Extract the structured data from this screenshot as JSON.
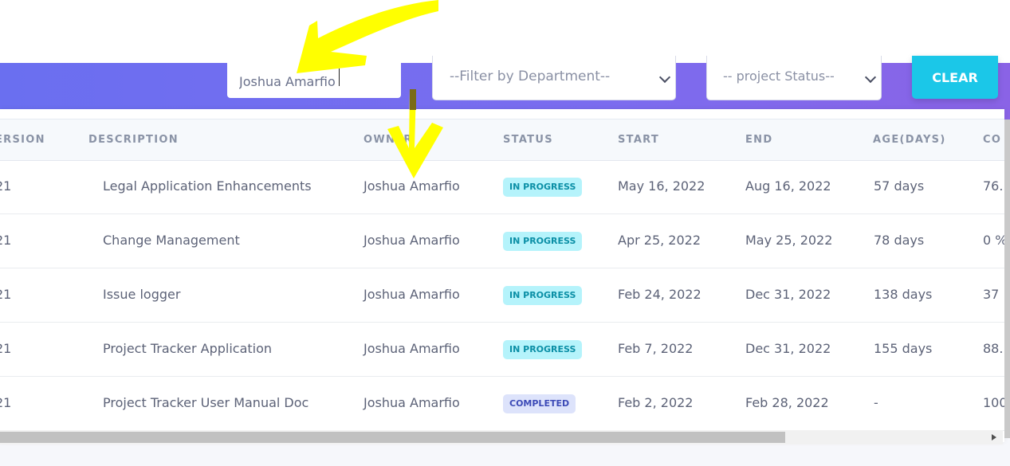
{
  "filters": {
    "search_value": "Joshua Amarfio",
    "department_placeholder": "--Filter by Department--",
    "status_placeholder": "-- project Status--",
    "clear_label": "CLEAR"
  },
  "table": {
    "headers": {
      "version": "ERSION",
      "description": "DESCRIPTION",
      "owner": "OWNER",
      "status": "STATUS",
      "start": "START",
      "end": "END",
      "age": "AGE(DAYS)",
      "completion": "CO"
    },
    "rows": [
      {
        "version": "21",
        "description": "Legal Application Enhancements",
        "owner": "Joshua Amarfio",
        "status": "IN PROGRESS",
        "status_type": "progress",
        "start": "May 16, 2022",
        "end": "Aug 16, 2022",
        "age": "57 days",
        "completion": "76."
      },
      {
        "version": "21",
        "description": "Change Management",
        "owner": "Joshua Amarfio",
        "status": "IN PROGRESS",
        "status_type": "progress",
        "start": "Apr 25, 2022",
        "end": "May 25, 2022",
        "age": "78 days",
        "completion": "0 %"
      },
      {
        "version": "21",
        "description": "Issue logger",
        "owner": "Joshua Amarfio",
        "status": "IN PROGRESS",
        "status_type": "progress",
        "start": "Feb 24, 2022",
        "end": "Dec 31, 2022",
        "age": "138 days",
        "completion": "37 '"
      },
      {
        "version": "21",
        "description": "Project Tracker Application",
        "owner": "Joshua Amarfio",
        "status": "IN PROGRESS",
        "status_type": "progress",
        "start": "Feb 7, 2022",
        "end": "Dec 31, 2022",
        "age": "155 days",
        "completion": "88."
      },
      {
        "version": "21",
        "description": "Project Tracker User Manual Doc",
        "owner": "Joshua Amarfio",
        "status": "COMPLETED",
        "status_type": "done",
        "start": "Feb 2, 2022",
        "end": "Feb 28, 2022",
        "age": "-",
        "completion": "100"
      }
    ]
  },
  "colors": {
    "banner": "#7b6cef",
    "clear_button": "#1bc7e8",
    "annotation": "#ffff00"
  },
  "icons": [
    "chevron-down-icon",
    "scroll-right-arrow-icon",
    "annotation-arrow-icon"
  ]
}
